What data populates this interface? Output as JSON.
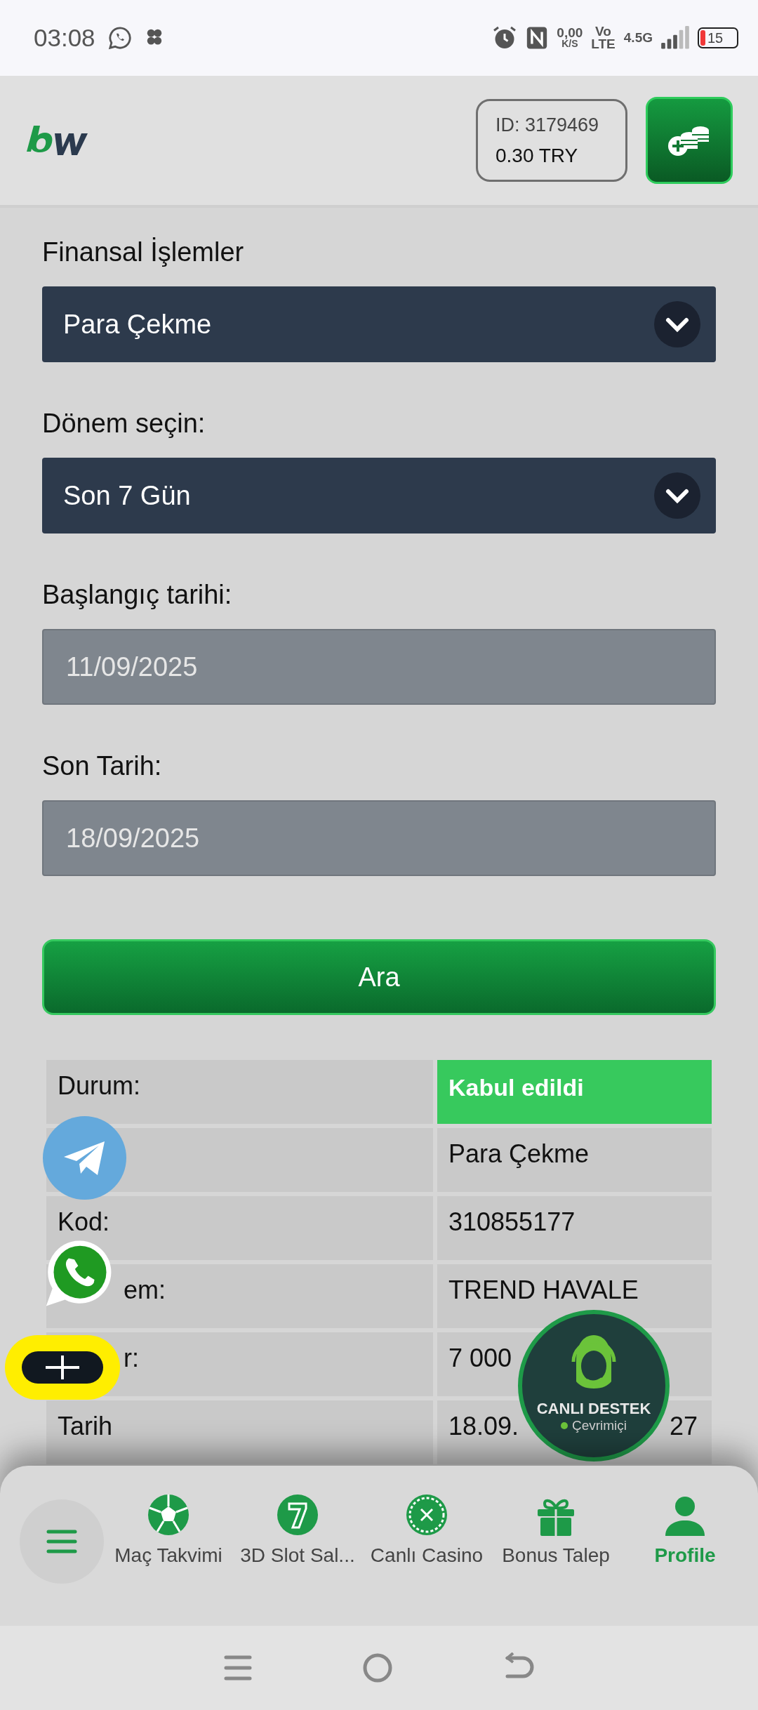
{
  "status_bar": {
    "time": "03:08",
    "net_speed": "0,00",
    "net_unit": "K/S",
    "volte_top": "Vo",
    "volte_bottom": "LTE",
    "network": "4.5G",
    "battery": "15"
  },
  "header": {
    "account_id": "ID: 3179469",
    "balance": "0.30 TRY"
  },
  "form": {
    "fields": [
      {
        "kind": "select",
        "label": "Finansal İşlemler",
        "value": "Para Çekme"
      },
      {
        "kind": "select",
        "label": "Dönem seçin:",
        "value": "Son 7 Gün"
      },
      {
        "kind": "date",
        "label": "Başlangıç tarihi:",
        "value": "11/09/2025"
      },
      {
        "kind": "date",
        "label": "Son Tarih:",
        "value": "18/09/2025"
      }
    ],
    "search_button": "Ara"
  },
  "details": [
    {
      "label": "Durum:",
      "value": "Kabul edildi",
      "status": true,
      "covered": false
    },
    {
      "value": "Para Çekme",
      "status": false
    },
    {
      "label": "Kod:",
      "value": "310855177",
      "status": false,
      "covered": false
    },
    {
      "label": "em:",
      "value": "TREND HAVALE",
      "status": false,
      "covered": true
    },
    {
      "label": "r:",
      "value": "7 000",
      "status": false,
      "covered": true
    },
    {
      "label": "Tarih",
      "value": "18.09.",
      "value_end": "27",
      "status": false,
      "covered": false
    }
  ],
  "live_support": {
    "title": "CANLI DESTEK",
    "status": "Çevrimiçi"
  },
  "bottom_nav": [
    {
      "kind": "soccer",
      "label": "Maç Takvimi",
      "selected": false
    },
    {
      "kind": "slot",
      "label": "3D Slot Sal...",
      "selected": false
    },
    {
      "kind": "roulette",
      "label": "Canlı Casino",
      "selected": false
    },
    {
      "kind": "gift",
      "label": "Bonus Talep",
      "selected": false
    },
    {
      "kind": "person",
      "label": "Profile",
      "selected": true
    }
  ]
}
